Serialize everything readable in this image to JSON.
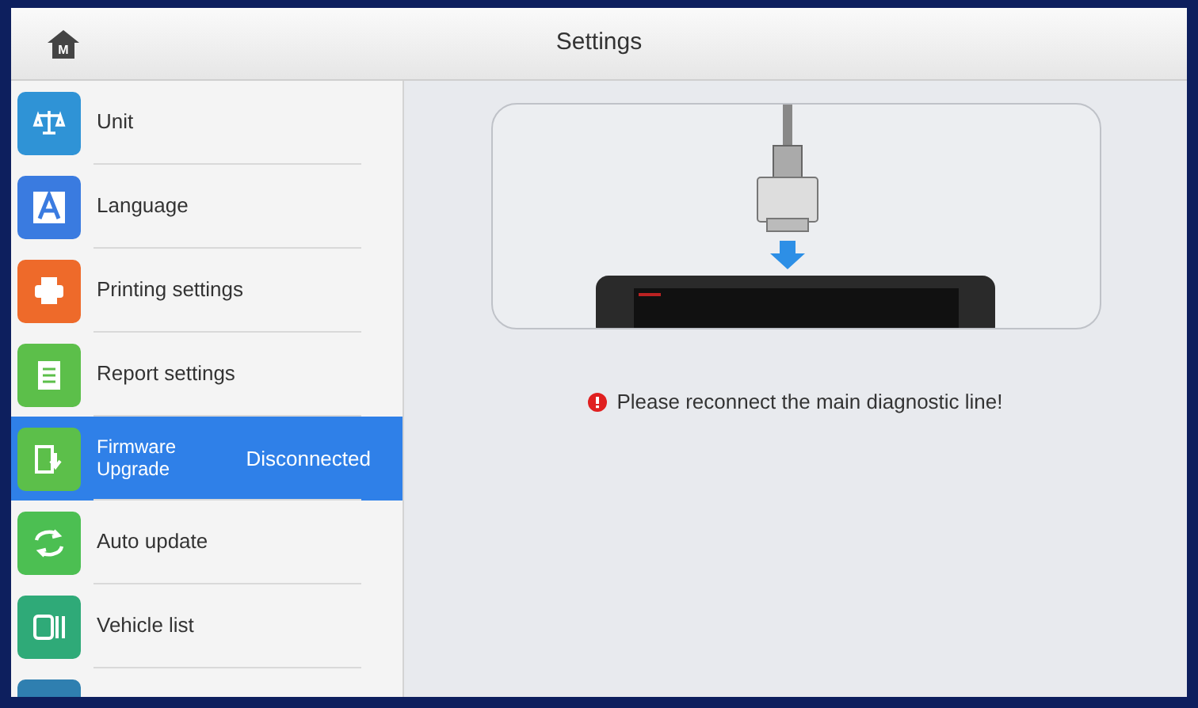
{
  "header": {
    "home_letter": "M",
    "title": "Settings"
  },
  "sidebar": {
    "items": [
      {
        "label": "Unit",
        "selected": false,
        "color": "#2f93d6"
      },
      {
        "label": "Language",
        "selected": false,
        "color": "#3a7be0"
      },
      {
        "label": "Printing settings",
        "selected": false,
        "color": "#ee6a2a"
      },
      {
        "label": "Report settings",
        "selected": false,
        "color": "#5cbf4a"
      },
      {
        "label": "Firmware Upgrade",
        "status": "Disconnected",
        "selected": true,
        "color": "#5cbf4a"
      },
      {
        "label": "Auto update",
        "selected": false,
        "color": "#4cbf52"
      },
      {
        "label": "Vehicle list",
        "selected": false,
        "color": "#2faa78"
      },
      {
        "selected": false,
        "color": "#2f7fb0"
      }
    ]
  },
  "content": {
    "message": "Please reconnect the main diagnostic line!"
  }
}
